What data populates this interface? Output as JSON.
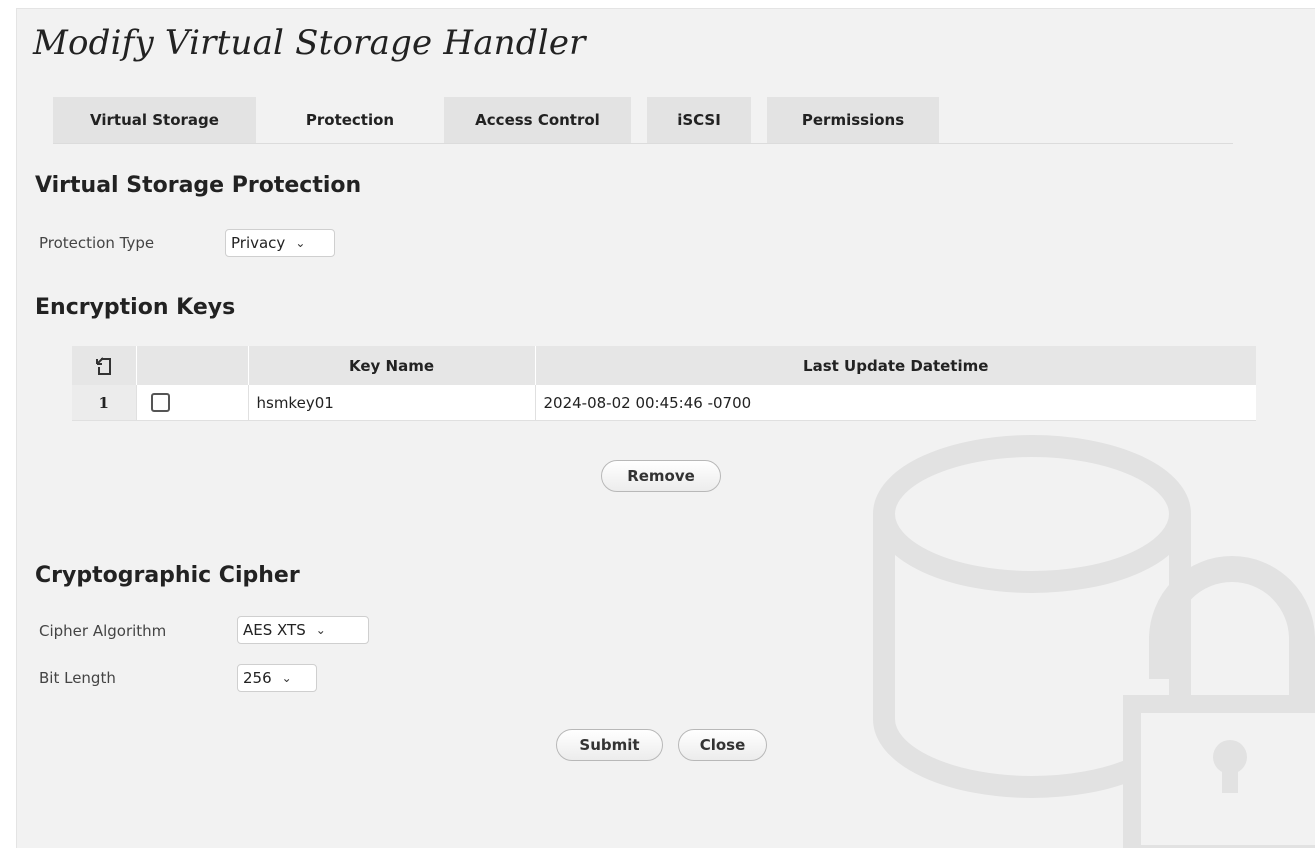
{
  "dialog": {
    "title": "Modify Virtual Storage Handler"
  },
  "tabs": [
    {
      "label": "Virtual Storage",
      "active": false
    },
    {
      "label": "Protection",
      "active": true
    },
    {
      "label": "Access Control",
      "active": false
    },
    {
      "label": "iSCSI",
      "active": false
    },
    {
      "label": "Permissions",
      "active": false
    }
  ],
  "protection_section": {
    "title": "Virtual Storage Protection",
    "protection_type_label": "Protection Type",
    "protection_type_value": "Privacy"
  },
  "encryption_keys": {
    "title": "Encryption Keys",
    "columns": [
      "Key Name",
      "Last Update Datetime"
    ],
    "header_icon": "export-icon",
    "rows": [
      {
        "num": "1",
        "checked": false,
        "key_name": "hsmkey01",
        "last_update": "2024-08-02 00:45:46 -0700"
      }
    ],
    "remove_label": "Remove"
  },
  "cipher_section": {
    "title": "Cryptographic Cipher",
    "algorithm_label": "Cipher Algorithm",
    "algorithm_value": "AES XTS",
    "bit_length_label": "Bit Length",
    "bit_length_value": "256"
  },
  "actions": {
    "submit_label": "Submit",
    "close_label": "Close"
  },
  "background_icon": "storage-lock-icon",
  "colors": {
    "panel_bg": "#f2f2f2",
    "tab_bg": "#e3e3e3",
    "header_bg": "#e6e6e6",
    "watermark": "#e2e2e2"
  }
}
